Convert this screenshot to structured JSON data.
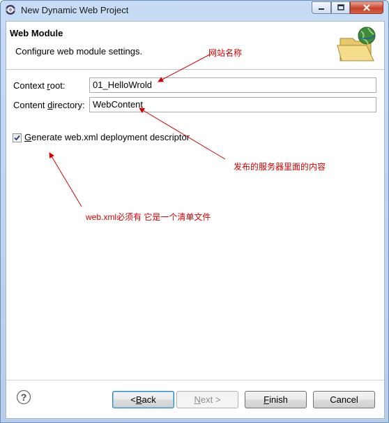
{
  "window": {
    "title": "New Dynamic Web Project"
  },
  "header": {
    "title": "Web Module",
    "description": "Configure web module settings."
  },
  "form": {
    "context_root": {
      "label_pre": "Context ",
      "label_mn": "r",
      "label_post": "oot:",
      "value": "01_HelloWrold"
    },
    "content_directory": {
      "label_pre": "Content ",
      "label_mn": "d",
      "label_post": "irectory:",
      "value": "WebContent"
    },
    "generate_xml": {
      "label_mn": "G",
      "label_post": "enerate web.xml deployment descriptor",
      "checked": true
    }
  },
  "annotations": {
    "site_name": "网站名称",
    "published": "发布的服务器里面的内容",
    "webxml": "web.xml必须有 它是一个清单文件"
  },
  "buttons": {
    "back": {
      "pre": "< ",
      "mn": "B",
      "post": "ack"
    },
    "next": {
      "pre": "",
      "mn": "N",
      "post": "ext >"
    },
    "finish": {
      "pre": "",
      "mn": "F",
      "post": "inish"
    },
    "cancel": {
      "label": "Cancel"
    }
  },
  "colors": {
    "annotation": "#d40000",
    "title_bar": "#c7dcf4",
    "default_button_border": "#3c7fb1"
  }
}
